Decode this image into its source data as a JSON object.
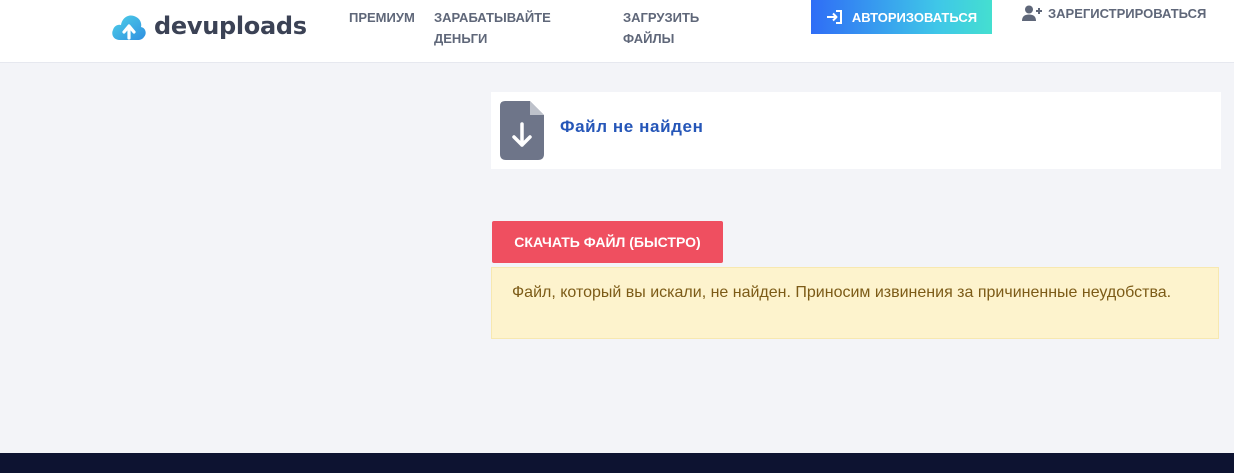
{
  "brand": {
    "name": "devuploads"
  },
  "nav": {
    "premium": "ПРЕМИУМ",
    "earn": "ЗАРАБАТЫВАЙТЕ\nДЕНЬГИ",
    "upload": "ЗАГРУЗИТЬ\nФАЙЛЫ",
    "login": "АВТОРИЗОВАТЬСЯ",
    "register": "ЗАРЕГИСТРИРОВАТЬСЯ"
  },
  "file": {
    "title": "Файл не найден"
  },
  "download_button": "СКАЧАТЬ ФАЙЛ (БЫСТРО)",
  "alert": {
    "message": "Файл, который вы искали, не найден. Приносим извинения за причиненные неудобства."
  },
  "colors": {
    "accent_blue": "#2556b8",
    "download_red": "#ef4f60",
    "alert_bg": "#fdf3cd",
    "footer": "#0d1331"
  }
}
